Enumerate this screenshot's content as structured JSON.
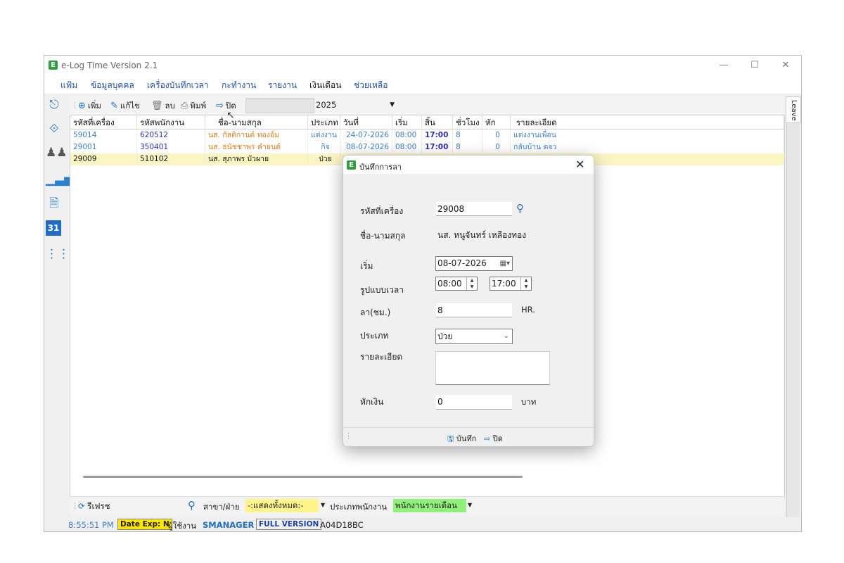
{
  "window": {
    "title": "e-Log Time Version 2.1",
    "logo_letter": "E"
  },
  "menu": [
    "แฟ้ม",
    "ข้อมูลบุคคล",
    "เครื่องบันทึกเวลา",
    "กะทำงาน",
    "รายงาน",
    "เงินเดือน",
    "ช่วยเหลือ"
  ],
  "toolbar": {
    "add": "เพิ่ม",
    "edit": "แก้ไข",
    "delete": "ลบ",
    "print": "พิมพ์",
    "close": "ปิด",
    "year": "2025"
  },
  "right_tab": "Leave",
  "grid": {
    "headers": [
      "รหัสที่เครื่อง",
      "รหัสพนักงาน",
      "ชื่อ-นามสกุล",
      "ประเภท",
      "วันที่",
      "เริ่ม",
      "สิ้น",
      "ชั่วโมง",
      "หัก",
      "รายละเอียด"
    ],
    "rows": [
      {
        "machine": "59014",
        "emp": "620512",
        "name": "นส. กัลติกานต์ ทองอ้ม",
        "type": "แต่งงาน",
        "date": "24-07-2026",
        "start": "08:00",
        "end": "17:00",
        "hours": "8",
        "deduct": "0",
        "detail": "แต่งงานเพื่อน"
      },
      {
        "machine": "29001",
        "emp": "350401",
        "name": "นส. ธนัชชาพร คำยนต์",
        "type": "กิจ",
        "date": "08-07-2026",
        "start": "08:00",
        "end": "17:00",
        "hours": "8",
        "deduct": "0",
        "detail": "กลับบ้าน ตจว"
      },
      {
        "machine": "29009",
        "emp": "510102",
        "name": "นส. สุภาพร บัวผาย",
        "type": "ป่วย",
        "date": "",
        "start": "",
        "end": "",
        "hours": "",
        "deduct": "",
        "detail": ""
      }
    ]
  },
  "bottombar": {
    "refresh": "รีเฟรช",
    "branch_label": "สาขา/ฝ่าย",
    "branch_value": "-:แสดงทั้งหมด:-",
    "emptype_label": "ประเภทพนักงาน",
    "emptype_value": "พนักงานรายเดือน"
  },
  "status": {
    "time": "8:55:51 PM",
    "date_exp": "Date Exp: N",
    "user_label": "ผู้ใช้งาน",
    "user": "SMANAGER",
    "version": "FULL VERSION",
    "code": "A04D18BC"
  },
  "dialog": {
    "title": "บันทึกการลา",
    "machine_label": "รหัสที่เครื่อง",
    "machine_value": "29008",
    "name_label": "ชื่อ-นามสกุล",
    "name_value": "นส. หนูจันทร์ เหลืองทอง",
    "start_label": "เริ่ม",
    "start_value": "08-07-2026",
    "time_label": "รูปแบบเวลา",
    "time_from": "08:00",
    "time_to": "17:00",
    "hours_label": "ลา(ชม.)",
    "hours_value": "8",
    "hours_unit": "HR.",
    "type_label": "ประเภท",
    "type_value": "ป่วย",
    "detail_label": "รายละเอียด",
    "detail_value": "",
    "deduct_label": "หักเงิน",
    "deduct_value": "0",
    "deduct_unit": "บาท",
    "save": "บันทึก",
    "close": "ปิด"
  }
}
